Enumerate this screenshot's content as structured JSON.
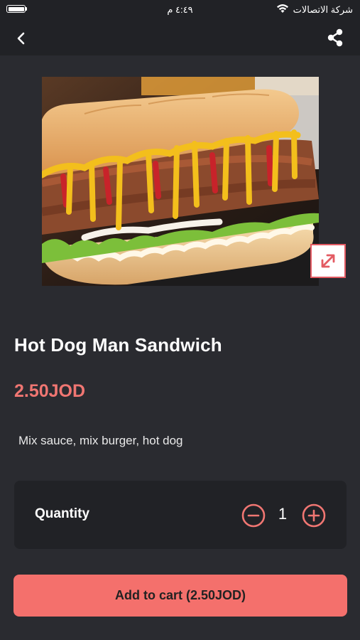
{
  "status_bar": {
    "time": "٤:٤٩ م",
    "carrier": "شركة الاتصالات"
  },
  "nav": {
    "back_icon": "chevron-left-icon",
    "share_icon": "share-icon"
  },
  "product": {
    "image": "hot-dog-sandwich-photo",
    "expand_icon": "expand-arrows-icon",
    "name": "Hot Dog Man Sandwich",
    "price": "2.50JOD",
    "description": "Mix sauce, mix burger, hot dog"
  },
  "quantity": {
    "label": "Quantity",
    "value": "1"
  },
  "cart": {
    "button_label": "Add to cart (2.50JOD)"
  },
  "colors": {
    "accent": "#f4706c",
    "background": "#2a2b30",
    "card": "#212226"
  }
}
